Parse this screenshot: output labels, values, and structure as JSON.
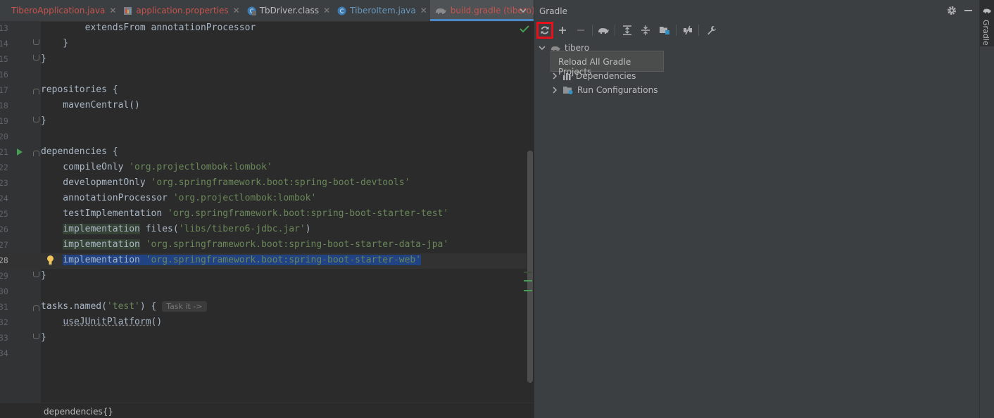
{
  "tabs": [
    {
      "label": "TiberoApplication.java",
      "color": "#c75450",
      "icon": "java-class-icon"
    },
    {
      "label": "application.properties",
      "color": "#c75450",
      "icon": "properties-file-icon"
    },
    {
      "label": "TbDriver.class",
      "color": "#bbbbbb",
      "icon": "class-file-icon"
    },
    {
      "label": "TiberoItem.java",
      "color": "#6897bb",
      "icon": "java-class-icon"
    },
    {
      "label": "build.gradle (tibero)",
      "color": "#c75450",
      "icon": "gradle-elephant-icon",
      "active": true
    }
  ],
  "editor": {
    "lines": [
      {
        "num": "13",
        "text": "        extendsFrom annotationProcessor"
      },
      {
        "num": "14",
        "text": "    }"
      },
      {
        "num": "15",
        "text": "}"
      },
      {
        "num": "16",
        "text": ""
      },
      {
        "num": "17",
        "text": "repositories {"
      },
      {
        "num": "18",
        "text": "    mavenCentral()"
      },
      {
        "num": "19",
        "text": "}"
      },
      {
        "num": "20",
        "text": ""
      },
      {
        "num": "21",
        "text": "dependencies {"
      },
      {
        "num": "22",
        "kw": "    compileOnly ",
        "str": "'org.projectlombok:lombok'"
      },
      {
        "num": "23",
        "kw": "    developmentOnly ",
        "str": "'org.springframework.boot:spring-boot-devtools'"
      },
      {
        "num": "24",
        "kw": "    annotationProcessor ",
        "str": "'org.projectlombok:lombok'"
      },
      {
        "num": "25",
        "kw": "    testImplementation ",
        "str": "'org.springframework.boot:spring-boot-starter-test'"
      },
      {
        "num": "26",
        "kw": "implementation",
        "mid": " files(",
        "str": "'libs/tibero6-jdbc.jar'",
        "end": ")"
      },
      {
        "num": "27",
        "kw": "implementation",
        "str": " 'org.springframework.boot:spring-boot-starter-data-jpa'"
      },
      {
        "num": "28",
        "kw": "implementation",
        "str": " 'org.springframework.boot:spring-boot-starter-web'"
      },
      {
        "num": "29",
        "text": "}"
      },
      {
        "num": "30",
        "text": ""
      },
      {
        "num": "31",
        "kw": "tasks.named(",
        "str": "'test'",
        "end": ") { ",
        "inlay": "Task it ->"
      },
      {
        "num": "32",
        "kw": "useJUnitPlatform",
        "end": "()"
      },
      {
        "num": "33",
        "text": "}"
      },
      {
        "num": "34",
        "text": ""
      }
    ],
    "breadcrumb": "dependencies{}"
  },
  "gradle": {
    "title": "Gradle",
    "tooltip": "Reload All Gradle Projects",
    "tree": {
      "root": "tibero",
      "children": [
        "Dependencies",
        "Run Configurations"
      ]
    },
    "side_tab": "Gradle"
  }
}
